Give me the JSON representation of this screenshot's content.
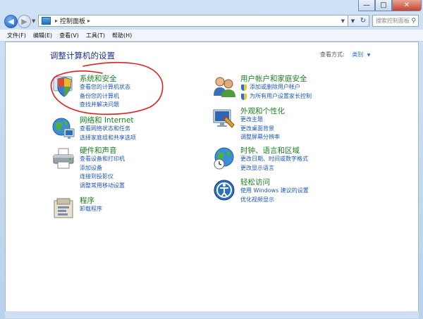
{
  "window": {
    "address_path": "控制面板",
    "search_placeholder": "搜索控制面板",
    "controls": {
      "minimize": "—",
      "maximize": "□",
      "close": "✕"
    }
  },
  "menu": {
    "items": [
      {
        "label": "文件(F)"
      },
      {
        "label": "编辑(E)"
      },
      {
        "label": "查看(V)"
      },
      {
        "label": "工具(T)"
      },
      {
        "label": "帮助(H)"
      }
    ]
  },
  "page": {
    "title": "调整计算机的设置",
    "view_by_label": "查看方式:",
    "view_by_value": "类别"
  },
  "categories": [
    {
      "title": "系统和安全",
      "icon": "shield-computer-icon",
      "links": [
        "查看您的计算机状态",
        "备份您的计算机",
        "查找并解决问题"
      ]
    },
    {
      "title": "网络和 Internet",
      "icon": "network-globe-icon",
      "links": [
        "查看网络状态和任务",
        "选择家庭组和共享选项"
      ]
    },
    {
      "title": "硬件和声音",
      "icon": "printer-icon",
      "links": [
        "查看设备和打印机",
        "添加设备",
        "连接到投影仪",
        "调整常用移动设置"
      ]
    },
    {
      "title": "程序",
      "icon": "programs-icon",
      "links": [
        "卸载程序"
      ]
    },
    {
      "title": "用户帐户和家庭安全",
      "icon": "users-icon",
      "links": [
        "添加或删除用户帐户",
        "为所有用户设置家长控制"
      ]
    },
    {
      "title": "外观和个性化",
      "icon": "monitor-paint-icon",
      "links": [
        "更改主题",
        "更改桌面背景",
        "调整屏幕分辨率"
      ]
    },
    {
      "title": "时钟、语言和区域",
      "icon": "clock-globe-icon",
      "links": [
        "更改日期、时间或数字格式",
        "更改显示语言"
      ]
    },
    {
      "title": "轻松访问",
      "icon": "accessibility-icon",
      "links": [
        "使用 Windows 建议的设置",
        "优化视频显示"
      ]
    }
  ],
  "colors": {
    "category_title": "#1b7e23",
    "link": "#1d57b3",
    "page_title": "#1e3287",
    "annotation": "#e0201b"
  }
}
